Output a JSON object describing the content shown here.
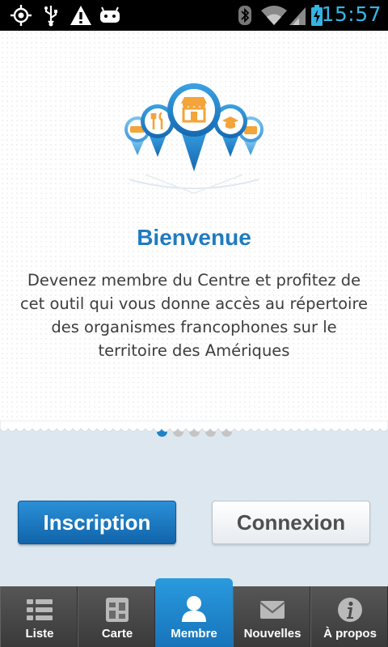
{
  "status_bar": {
    "time": "15:57",
    "icons": [
      "gps-icon",
      "usb-icon",
      "warning-icon",
      "android-debug-icon",
      "bluetooth-icon",
      "wifi-icon",
      "signal-icon",
      "battery-charging-icon"
    ]
  },
  "welcome": {
    "title": "Bienvenue",
    "body": "Devenez membre du Centre et profitez de cet outil qui vous donne accès au répertoire des organismes francophones sur le territoire des Amériques",
    "pager": {
      "total": 5,
      "active_index": 0
    }
  },
  "actions": {
    "register_label": "Inscription",
    "login_label": "Connexion"
  },
  "tabs": [
    {
      "label": "Liste",
      "icon": "list-icon"
    },
    {
      "label": "Carte",
      "icon": "map-icon"
    },
    {
      "label": "Membre",
      "icon": "member-icon",
      "active": true
    },
    {
      "label": "Nouvelles",
      "icon": "news-icon"
    },
    {
      "label": "À propos",
      "icon": "info-icon"
    }
  ],
  "colors": {
    "accent": "#1f7bbf",
    "primary_button": "#1a78c2",
    "active_tab": "#2088cf",
    "status_time": "#34b4e4",
    "tab_bar": "#474747"
  }
}
